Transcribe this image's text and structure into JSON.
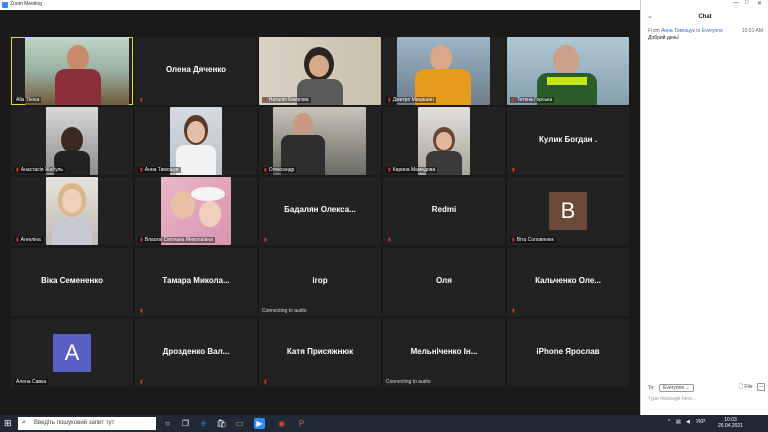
{
  "window": {
    "title": "Zoom Meeting"
  },
  "participants": [
    {
      "label": "Alla Tkova",
      "video": true,
      "active": true
    },
    {
      "name": "Олена Дяченко",
      "video": false
    },
    {
      "label": "Наталія Бекірова",
      "video": true
    },
    {
      "label": "Дмитро Мицишин",
      "video": true
    },
    {
      "label": "Тетяна Горська",
      "video": true
    },
    {
      "label": "Анастасія Жабуль",
      "video": true
    },
    {
      "label": "Анна Тимощук",
      "video": true
    },
    {
      "label": "Олександр",
      "video": true
    },
    {
      "label": "Карина Мамедова",
      "video": true
    },
    {
      "name": "Кулик Богдан .",
      "video": false
    },
    {
      "label": "Ангеліна",
      "video": true
    },
    {
      "label": "Власюк Світлана Миколаївна",
      "video": true
    },
    {
      "name": "Бадалян Олекса...",
      "video": false
    },
    {
      "name": "Redmi",
      "video": false
    },
    {
      "label": "Віта Соловянюк",
      "video": false,
      "avatar_letter": "В"
    },
    {
      "name": "Віка Семененко",
      "video": false
    },
    {
      "name": "Тамара Микола...",
      "video": false
    },
    {
      "name": "ігор",
      "video": false,
      "status": "Connecting to audio"
    },
    {
      "name": "Оля",
      "video": false
    },
    {
      "name": "Кальченко Оле...",
      "video": false
    },
    {
      "label": "Алена Савка",
      "video": false,
      "avatar_letter": "А"
    },
    {
      "name": "Дрозденко Вал...",
      "video": false
    },
    {
      "name": "Катя Присяжнюк",
      "video": false
    },
    {
      "name": "Мельніченко Ін...",
      "video": false,
      "status": "Connecting to audio"
    },
    {
      "name": "iPhone Ярослав",
      "video": false
    }
  ],
  "chat": {
    "title": "Chat",
    "message": {
      "from_prefix": "From",
      "sender": "Анна Тимощук",
      "to_text": "to",
      "recipient": "Everyone",
      "time": "10:01 AM",
      "text": "Добрий день!"
    },
    "to_label": "To:",
    "to_value": "Everyone",
    "file_label": "File",
    "placeholder": "Type message here..."
  },
  "taskbar": {
    "search_placeholder": "Введіть пошуковий запит тут",
    "lang": "УКР",
    "time": "10:03",
    "date": "26.04.2021"
  }
}
